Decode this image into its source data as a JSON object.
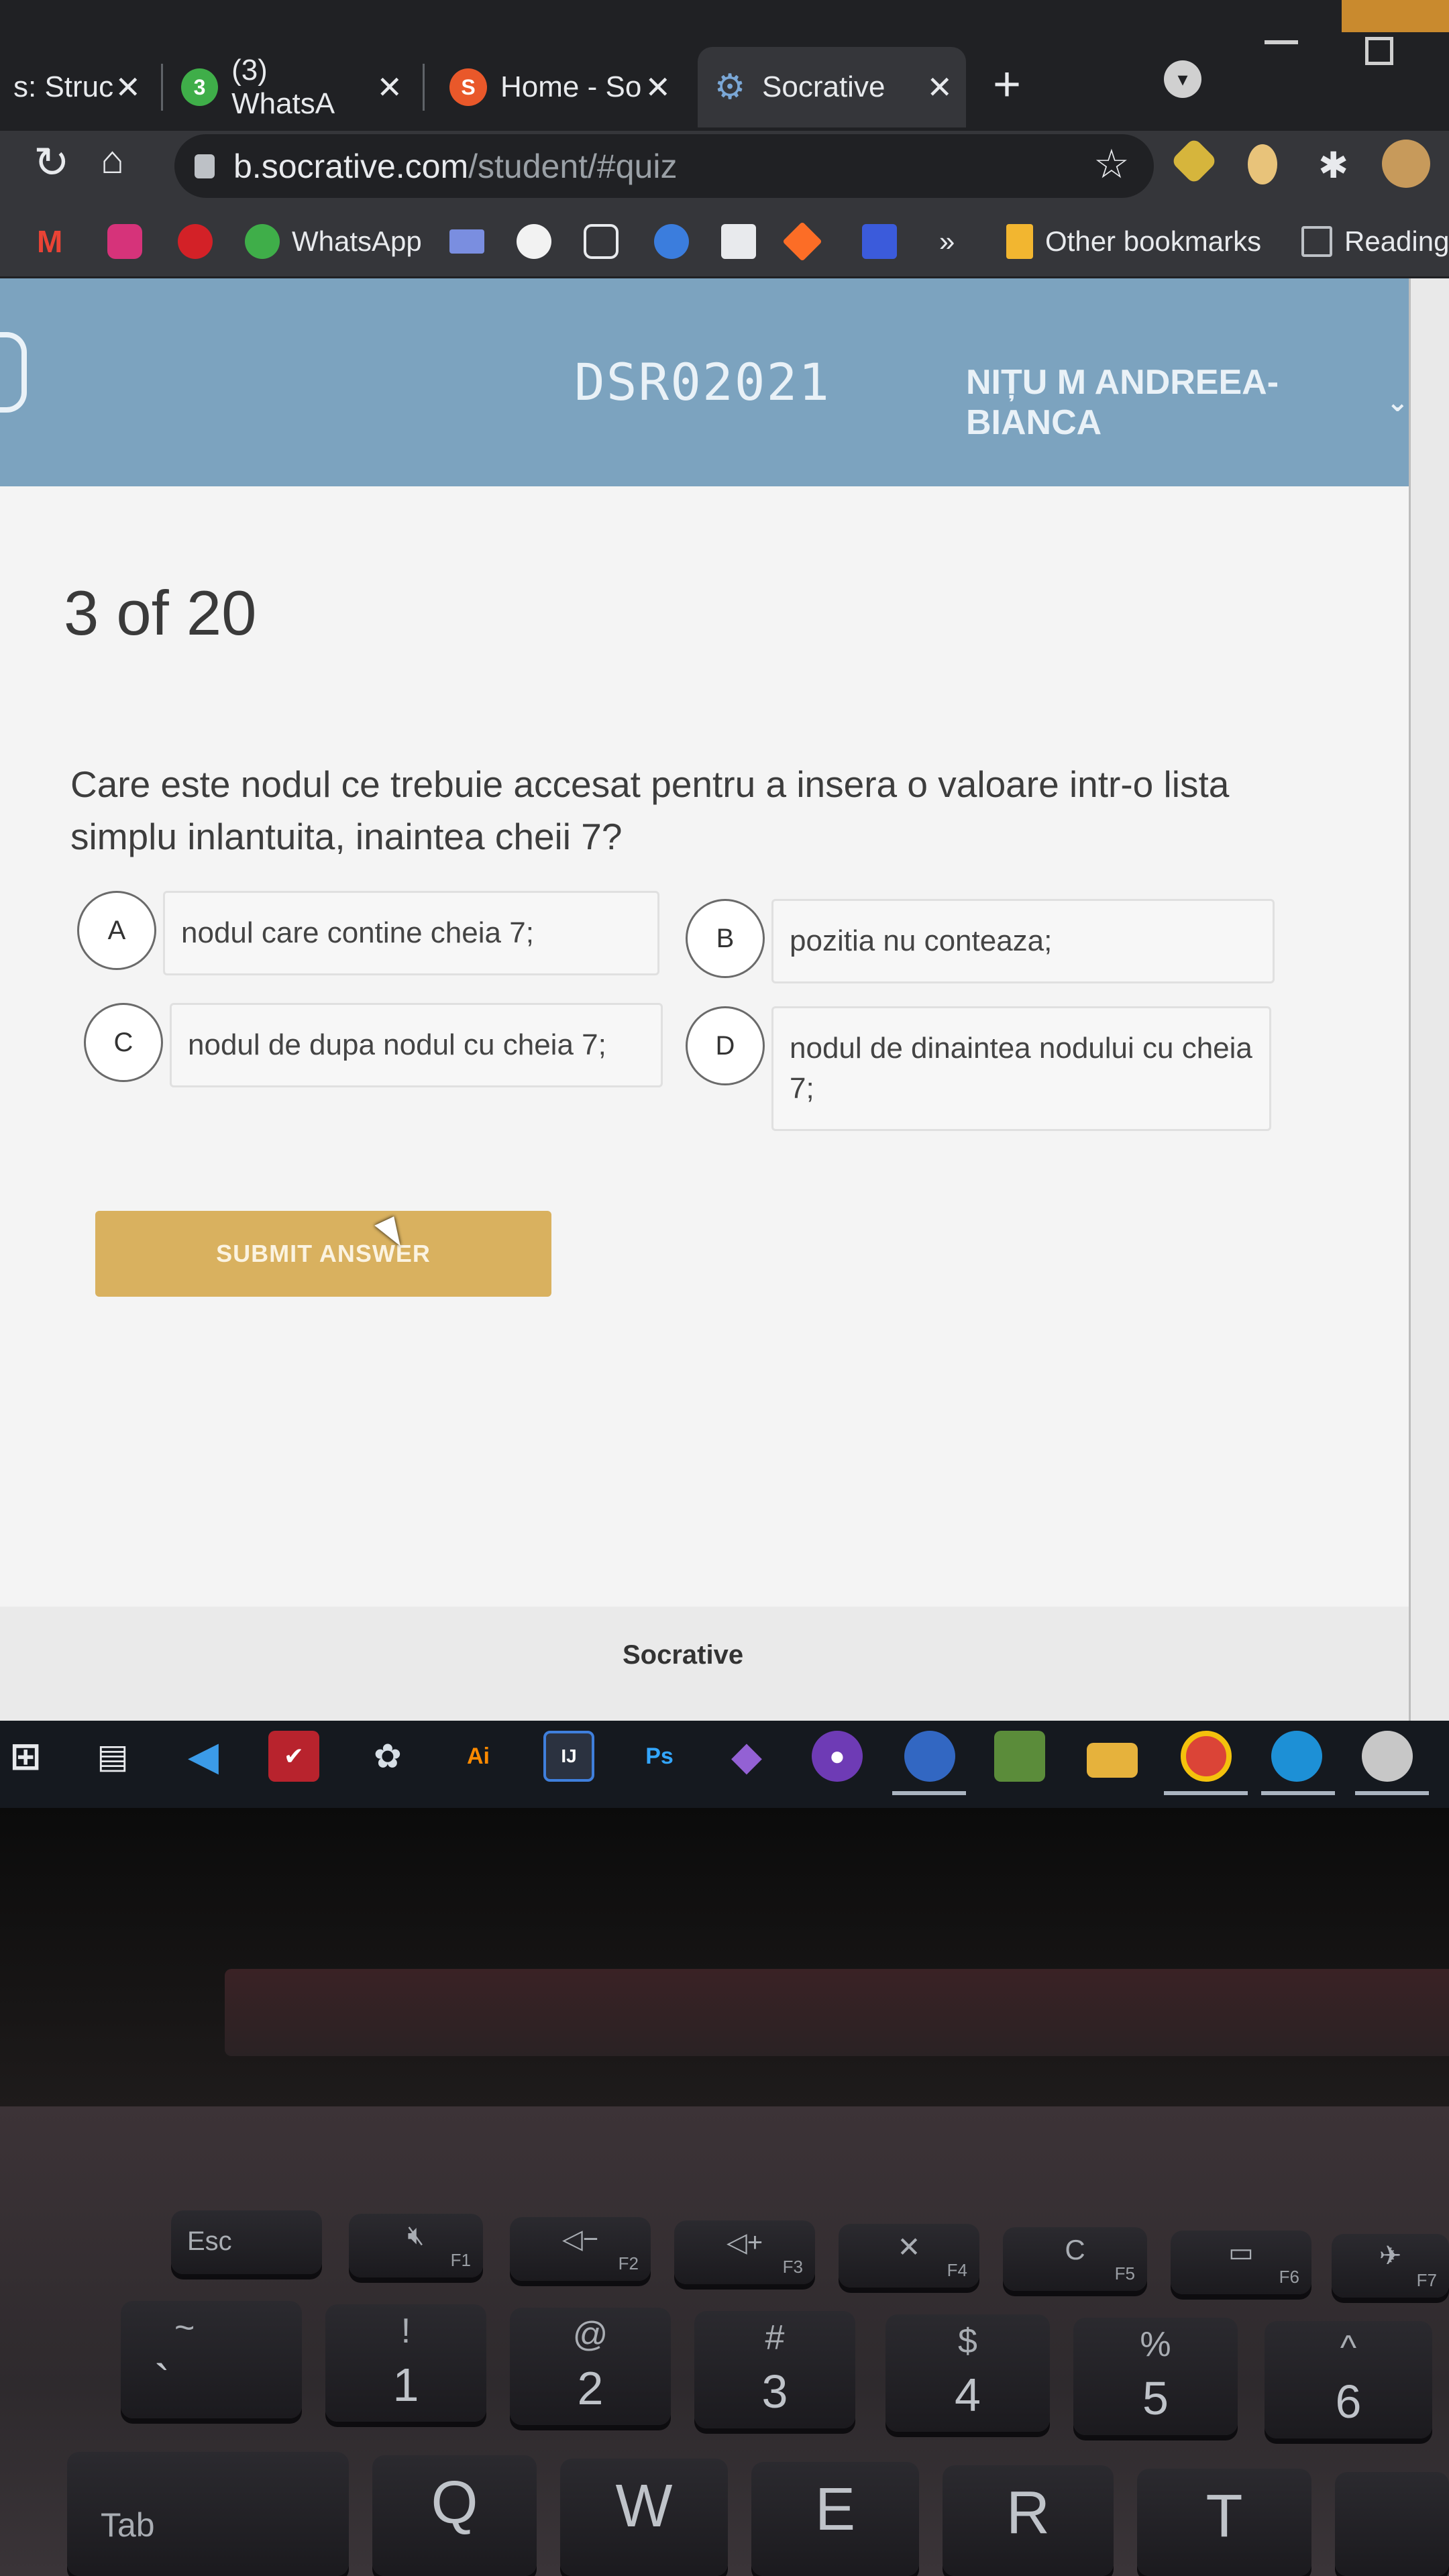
{
  "browser": {
    "tabs": [
      {
        "title": "s: Struc",
        "active": false
      },
      {
        "title": "(3) WhatsA",
        "active": false
      },
      {
        "title": "Home - So",
        "active": false
      },
      {
        "title": "Socrative",
        "active": true
      }
    ],
    "address": {
      "host": "b.socrative.com",
      "path": "/student/#quiz"
    },
    "bookmarks": {
      "whatsapp": "WhatsApp",
      "overflow": "»",
      "other": "Other bookmarks",
      "reading": "Reading"
    }
  },
  "quiz": {
    "room_code": "DSR02021",
    "student_name": "NIȚU M ANDREEA-BIANCA",
    "progress": "3 of 20",
    "question": "Care este nodul ce trebuie accesat pentru a insera o valoare intr-o lista simplu inlantuita, inaintea cheii 7?",
    "answers": [
      {
        "letter": "A",
        "text": "nodul care contine cheia 7;"
      },
      {
        "letter": "B",
        "text": "pozitia nu conteaza;"
      },
      {
        "letter": "C",
        "text": "nodul de dupa nodul cu cheia 7;"
      },
      {
        "letter": "D",
        "text": "nodul de dinaintea nodului cu cheia 7;"
      }
    ],
    "submit_label": "SUBMIT ANSWER",
    "footer": "Socrative"
  },
  "taskbar": {
    "illustrator": "Ai",
    "intellij": "IJ",
    "photoshop": "Ps"
  },
  "keyboard": {
    "esc": "Esc",
    "tab": "Tab",
    "fn_keys": [
      "F1",
      "F2",
      "F3",
      "F4",
      "F5",
      "F6",
      "F7"
    ],
    "number_row": [
      {
        "top": "~",
        "main": "`"
      },
      {
        "top": "!",
        "main": "1"
      },
      {
        "top": "@",
        "main": "2"
      },
      {
        "top": "#",
        "main": "3"
      },
      {
        "top": "$",
        "main": "4"
      },
      {
        "top": "%",
        "main": "5"
      },
      {
        "top": "^",
        "main": "6"
      }
    ],
    "letters": [
      "Q",
      "W",
      "E",
      "R",
      "T"
    ]
  },
  "colors": {
    "header_blue": "#7ca3bf",
    "submit_gold": "#d9b15f",
    "browser_dark": "#202124"
  }
}
